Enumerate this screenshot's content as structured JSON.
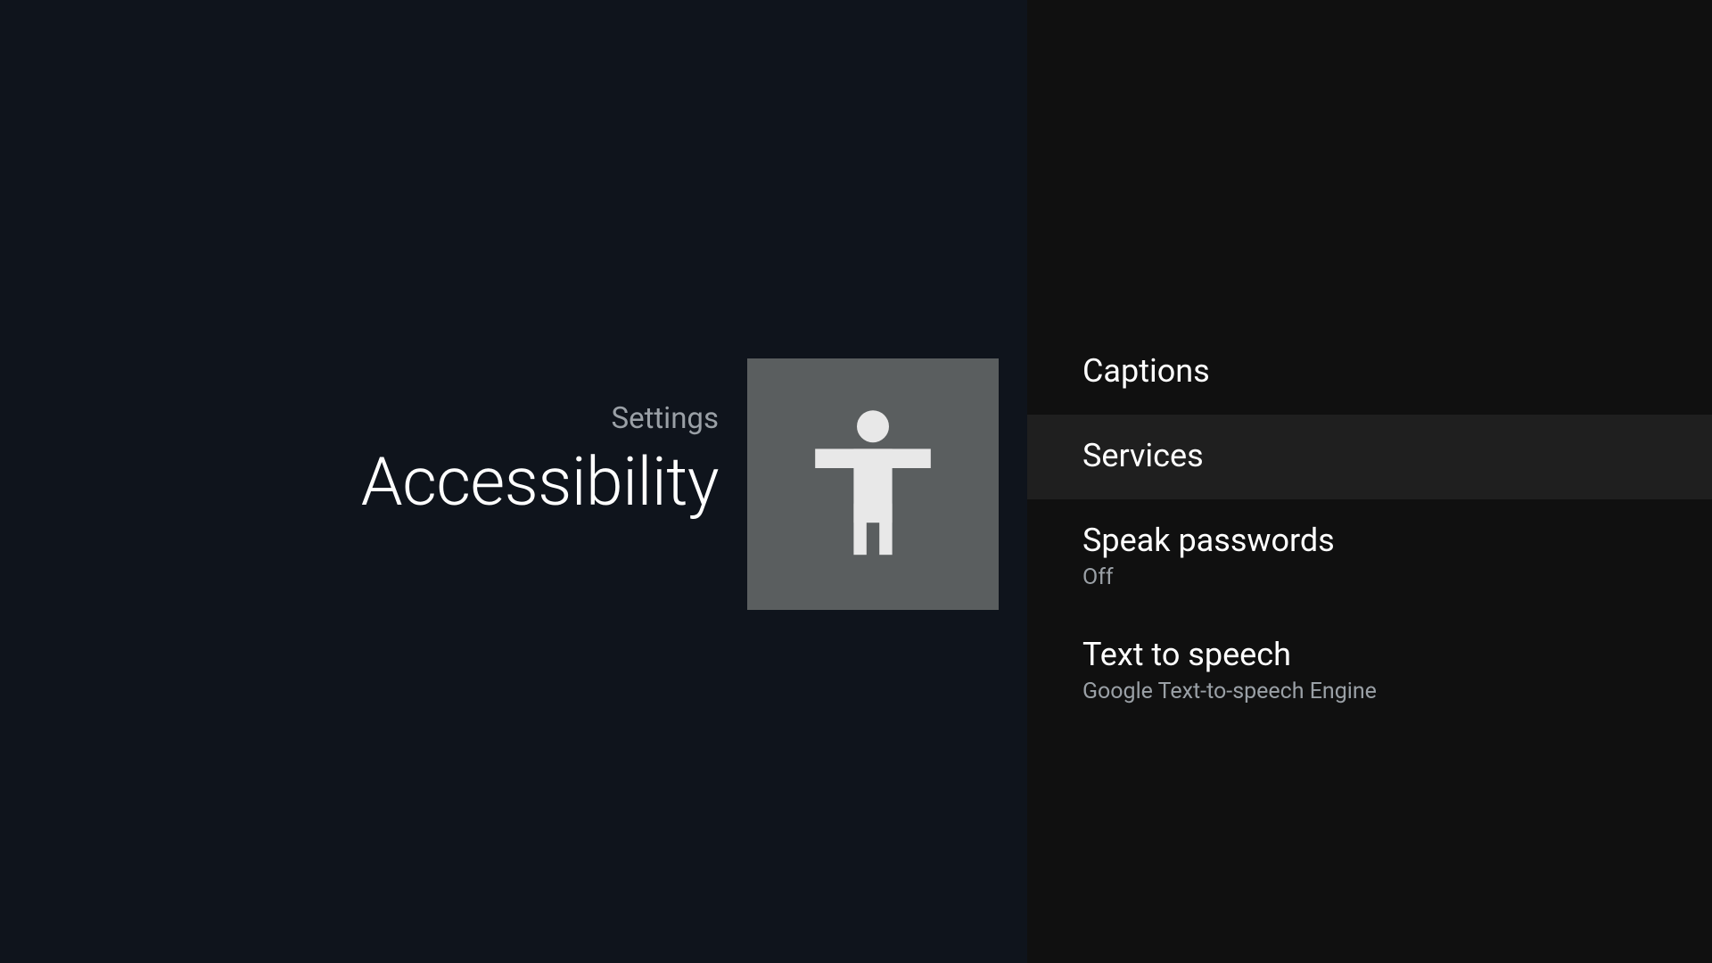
{
  "header": {
    "breadcrumb": "Settings",
    "title": "Accessibility",
    "icon": "accessibility-icon"
  },
  "menu": {
    "items": [
      {
        "title": "Captions",
        "subtitle": "",
        "highlight": false
      },
      {
        "title": "Services",
        "subtitle": "",
        "highlight": true
      },
      {
        "title": "Speak passwords",
        "subtitle": "Off",
        "highlight": false
      },
      {
        "title": "Text to speech",
        "subtitle": "Google Text-to-speech Engine",
        "highlight": false
      }
    ]
  },
  "colors": {
    "leftBg": "#0f141c",
    "rightBg": "#101010",
    "iconBg": "#5a5e5f",
    "highlightBg": "#1f1f1f",
    "textPrimary": "#ffffff",
    "textSecondary": "#9aa0a6"
  }
}
